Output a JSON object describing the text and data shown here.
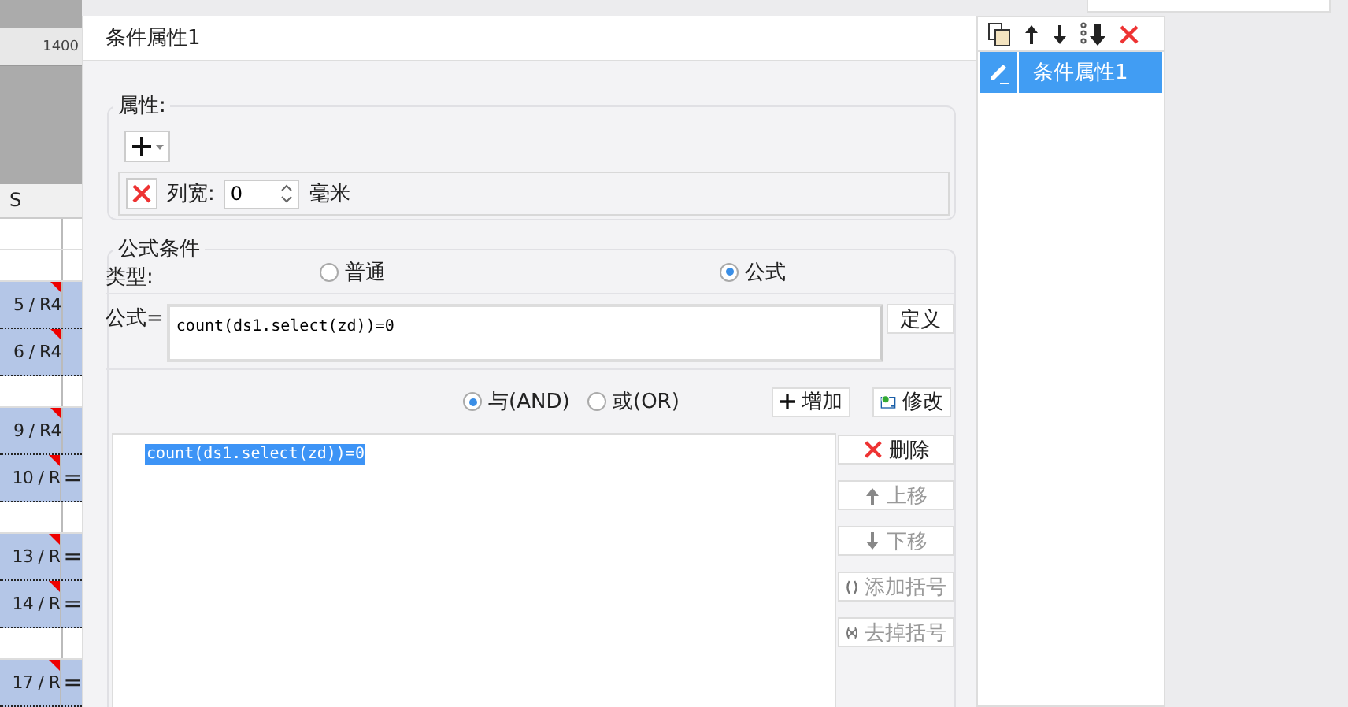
{
  "sheet": {
    "ruler_label": "1400",
    "column_header": "S",
    "rows": [
      {
        "text": "",
        "extra": "",
        "highlighted": false
      },
      {
        "text": "",
        "extra": "",
        "highlighted": false
      },
      {
        "text": "5 / R4",
        "extra": "",
        "highlighted": true
      },
      {
        "text": "6 / R4",
        "extra": "",
        "highlighted": true
      },
      {
        "text": "",
        "extra": "",
        "highlighted": false
      },
      {
        "text": "9 / R4",
        "extra": "",
        "highlighted": true
      },
      {
        "text": "10 / R",
        "extra": "=",
        "highlighted": true
      },
      {
        "text": "",
        "extra": "",
        "highlighted": false
      },
      {
        "text": "13 / R",
        "extra": "=",
        "highlighted": true
      },
      {
        "text": "14 / R",
        "extra": "=",
        "highlighted": true
      },
      {
        "text": "",
        "extra": "",
        "highlighted": false
      },
      {
        "text": "17 / R",
        "extra": "=",
        "highlighted": true
      }
    ]
  },
  "dialog": {
    "title": "条件属性1",
    "attributes": {
      "legend": "属性:",
      "width_label": "列宽:",
      "width_value": "0",
      "unit": "毫米"
    },
    "formula_condition": {
      "legend": "公式条件",
      "type_label": "类型:",
      "types": [
        {
          "label": "普通",
          "selected": false
        },
        {
          "label": "公式",
          "selected": true
        }
      ],
      "formula_label": "公式=",
      "formula_value": "count(ds1.select(zd))=0",
      "define_button": "定义",
      "joins": [
        {
          "label": "与(AND)",
          "selected": true
        },
        {
          "label": "或(OR)",
          "selected": false
        }
      ],
      "add_button": "增加",
      "modify_button": "修改",
      "conditions": [
        {
          "text": "count(ds1.select(zd))=0",
          "selected": true
        }
      ],
      "actions": [
        {
          "kind": "delete",
          "label": "删除",
          "disabled": false
        },
        {
          "kind": "up",
          "label": "上移",
          "disabled": true
        },
        {
          "kind": "down",
          "label": "下移",
          "disabled": true
        },
        {
          "kind": "add-paren",
          "label": "添加括号",
          "disabled": true
        },
        {
          "kind": "remove-paren",
          "label": "去掉括号",
          "disabled": true
        }
      ]
    }
  },
  "side_list": {
    "items": [
      {
        "label": "条件属性1",
        "selected": true
      }
    ]
  }
}
